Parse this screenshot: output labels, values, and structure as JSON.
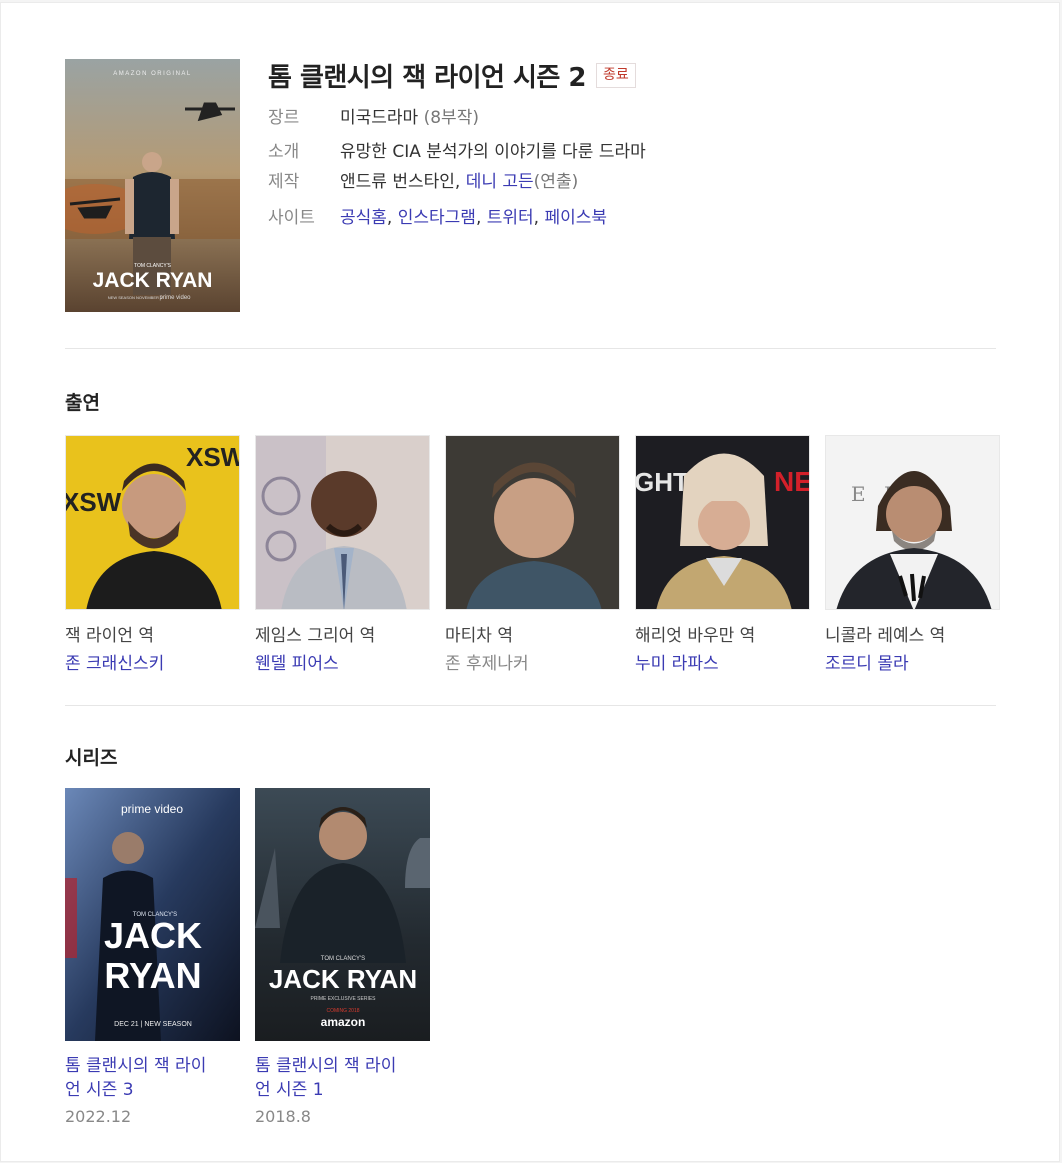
{
  "header": {
    "title": "톰 클랜시의 잭 라이언 시즌 2",
    "status_badge": "종료",
    "poster": {
      "top_text": "AMAZON ORIGINAL",
      "small_text": "TOM CLANCY'S",
      "logo_text": "JACK RYAN",
      "bottom_text": "NEW SEASON NOVEMBER 1",
      "brand_text": "prime video"
    },
    "genre": {
      "label": "장르",
      "value": "미국드라마",
      "extra": " (8부작)"
    },
    "intro": {
      "label": "소개",
      "value": "유망한 CIA 분석가의 이야기를 다룬 드라마"
    },
    "production": {
      "label": "제작",
      "person1": "앤드류 번스타인",
      "separator": ", ",
      "person2": "데니 고든",
      "role": "(연출)"
    },
    "site": {
      "label": "사이트",
      "links": [
        "공식홈",
        "인스타그램",
        "트위터",
        "페이스북"
      ],
      "separator": ", "
    }
  },
  "cast": {
    "title": "출연",
    "items": [
      {
        "role": "잭 라이언 역",
        "actor": "존 크래신스키",
        "linked": true
      },
      {
        "role": "제임스 그리어 역",
        "actor": "웬델 피어스",
        "linked": true
      },
      {
        "role": "마티차 역",
        "actor": "존 후제나커",
        "linked": false
      },
      {
        "role": "해리엇 바우만 역",
        "actor": "누미 라파스",
        "linked": true
      },
      {
        "role": "니콜라 레예스 역",
        "actor": "조르디 몰라",
        "linked": true
      }
    ],
    "photo_texts": {
      "sxsw": "XSW",
      "netflix": "NET",
      "esquire": "E   R E"
    }
  },
  "series": {
    "title": "시리즈",
    "items": [
      {
        "title_line1": "톰 클랜시의 잭 라이",
        "title_line2": "언 시즌 3",
        "date": "2022.12",
        "poster": {
          "brand": "prime video",
          "small": "TOM CLANCY'S",
          "logo1": "JACK",
          "logo2": "RYAN",
          "bottom": "DEC 21 | NEW SEASON"
        }
      },
      {
        "title_line1": "톰 클랜시의 잭 라이",
        "title_line2": "언 시즌 1",
        "date": "2018.8",
        "poster": {
          "small": "TOM CLANCY'S",
          "logo": "JACK RYAN",
          "sub": "PRIME EXCLUSIVE SERIES",
          "coming": "COMING 2018",
          "brand": "amazon"
        }
      }
    ]
  },
  "colors": {
    "link": "#3b3bb3",
    "badge": "#c0392b"
  }
}
